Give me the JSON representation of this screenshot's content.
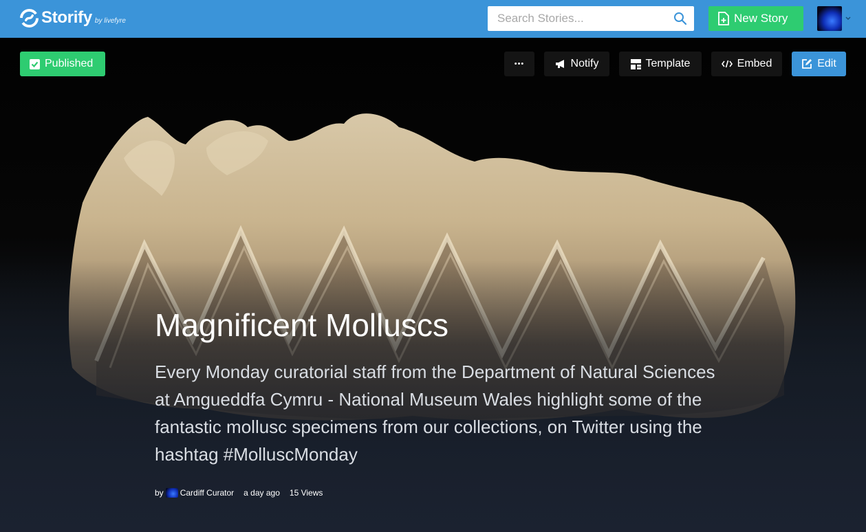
{
  "header": {
    "logo_name": "Storify",
    "logo_by": "by livefyre",
    "search_placeholder": "Search Stories...",
    "new_story_label": "New Story"
  },
  "toolbar": {
    "status_label": "Published",
    "more_label": "•••",
    "notify_label": "Notify",
    "template_label": "Template",
    "embed_label": "Embed",
    "edit_label": "Edit"
  },
  "story": {
    "title": "Magnificent Molluscs",
    "description": "Every Monday curatorial staff from the Department of Natural Sciences at Amgueddfa Cymru - National Museum Wales highlight some of the fantastic mollusc specimens from our collections, on Twitter using the hashtag #MolluscMonday",
    "by_prefix": "by",
    "author": "Cardiff Curator",
    "time_ago": "a day ago",
    "views": "15 Views"
  },
  "colors": {
    "brand_blue": "#3b94d9",
    "green": "#2ecc71",
    "dark_button": "#141414"
  },
  "icons": {
    "logo": "storify-logo-icon",
    "search": "search-icon",
    "new_story": "new-document-icon",
    "published": "checkbox-icon",
    "notify": "megaphone-icon",
    "template": "template-icon",
    "embed": "code-icon",
    "edit": "edit-icon",
    "caret": "chevron-down-icon"
  }
}
